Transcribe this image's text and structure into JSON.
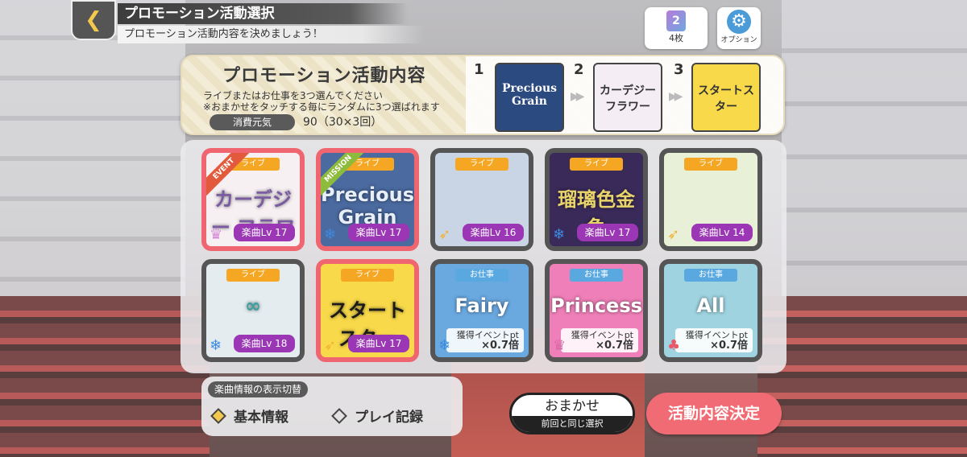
{
  "header": {
    "title": "プロモーション活動選択",
    "subtitle": "プロモーション活動内容を決めましょう！",
    "back_glyph": "❮"
  },
  "top_right": {
    "ticket_icon_text": "2",
    "ticket_count": "4枚",
    "option_label": "オプション"
  },
  "promo": {
    "title": "プロモーション活動内容",
    "line1": "ライブまたはお仕事を3つ選んでください",
    "line2": "※おまかせをタッチする毎にランダムに3つ選ばれます",
    "cost_label": "消費元気",
    "cost_value": "90（30×3回）",
    "slots": [
      {
        "num": "1",
        "art_text": "Precious Grain",
        "color": "#2b4a80"
      },
      {
        "num": "2",
        "art_text": "カーデジー フラワー",
        "color": "#f4eef4"
      },
      {
        "num": "3",
        "art_text": "スタートスター",
        "color": "#f8d94a"
      }
    ],
    "arrow": "▶▶"
  },
  "cards": [
    {
      "tag": "ライブ",
      "lv": "楽曲Lv 17",
      "art": "カーデジー フラワー",
      "selected": true,
      "ribbon": "EVENT",
      "ribbon_color": "#e25a3b",
      "bg": "#f6f0f3",
      "mark": "♛",
      "mark_color": "#d58ad8",
      "art_color": "#7a5aa0"
    },
    {
      "tag": "ライブ",
      "lv": "楽曲Lv 17",
      "art": "Precious Grain",
      "selected": true,
      "ribbon": "MISSION",
      "ribbon_color": "#8dbb3c",
      "bg": "#4a6aa0",
      "mark": "❄",
      "mark_color": "#3e8ae0",
      "art_color": "#e8eef8"
    },
    {
      "tag": "ライブ",
      "lv": "楽曲Lv 16",
      "art": "",
      "selected": false,
      "ribbon": "",
      "bg": "#c9d4e4",
      "mark": "➶",
      "mark_color": "#f2b234",
      "art_color": "#fff"
    },
    {
      "tag": "ライブ",
      "lv": "楽曲Lv 17",
      "art": "瑠璃色金魚",
      "selected": false,
      "ribbon": "",
      "bg": "#3a2a5a",
      "mark": "❄",
      "mark_color": "#3e8ae0",
      "art_color": "#e9d46b"
    },
    {
      "tag": "ライブ",
      "lv": "楽曲Lv 14",
      "art": "",
      "selected": false,
      "ribbon": "",
      "bg": "#e8f0d8",
      "mark": "➶",
      "mark_color": "#f2b234",
      "art_color": "#444"
    },
    {
      "tag": "ライブ",
      "lv": "楽曲Lv 18",
      "art": "∞",
      "selected": false,
      "ribbon": "",
      "bg": "#e4ecf0",
      "mark": "❄",
      "mark_color": "#3e8ae0",
      "art_color": "#3aa0a0"
    },
    {
      "tag": "ライブ",
      "lv": "楽曲Lv 17",
      "art": "スタートスター",
      "selected": true,
      "ribbon": "",
      "bg": "#f8d94a",
      "mark": "➶",
      "mark_color": "#f2b234",
      "art_color": "#1a1a1a"
    },
    {
      "tag": "お仕事",
      "pt": "獲得イベントpt",
      "mult": "×0.7倍",
      "art": "Fairy",
      "selected": false,
      "ribbon": "",
      "bg": "#6aa8e0",
      "mark": "❄",
      "mark_color": "#3e8ae0",
      "art_color": "#fff",
      "job": true
    },
    {
      "tag": "お仕事",
      "pt": "獲得イベントpt",
      "mult": "×0.7倍",
      "art": "Princess",
      "selected": false,
      "ribbon": "",
      "bg": "#ef7fb8",
      "mark": "♛",
      "mark_color": "#d86aa8",
      "art_color": "#fff",
      "job": true
    },
    {
      "tag": "お仕事",
      "pt": "獲得イベントpt",
      "mult": "×0.7倍",
      "art": "All",
      "selected": false,
      "ribbon": "",
      "bg": "#9fd3e0",
      "mark": "♣",
      "mark_color": "#e85a6a",
      "art_color": "#fff",
      "job": true
    }
  ],
  "toggle": {
    "title": "楽曲情報の表示切替",
    "opt1": "基本情報",
    "opt2": "プレイ記録"
  },
  "buttons": {
    "omakase": "おまかせ",
    "omakase_sub": "前回と同じ選択",
    "decide": "活動内容決定"
  }
}
